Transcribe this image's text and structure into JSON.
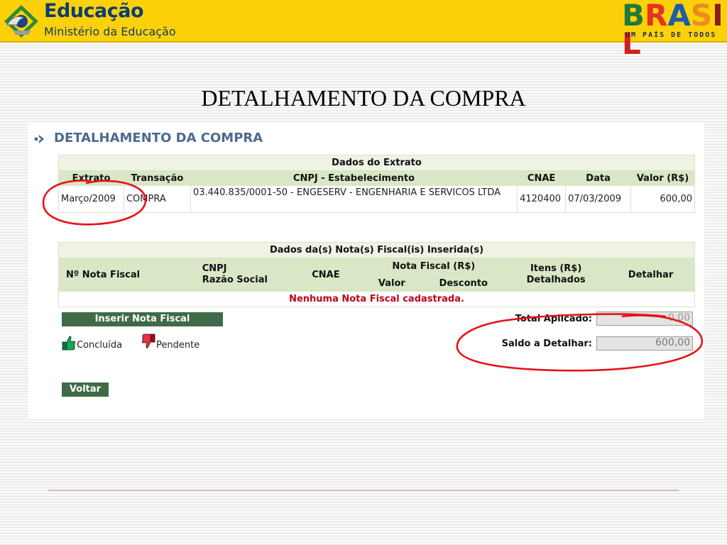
{
  "header": {
    "logo_title": "Educação",
    "logo_subtitle": "Ministério da Educação",
    "brasil_word": "BRASIL",
    "brasil_slogan": "UM PAÍS DE TODOS"
  },
  "slide_title": "DETALHAMENTO DA COMPRA",
  "page": {
    "section_title": "DETALHAMENTO DA COMPRA",
    "extrato": {
      "caption": "Dados do Extrato",
      "columns": [
        "Extrato",
        "Transação",
        "CNPJ - Estabelecimento",
        "CNAE",
        "Data",
        "Valor (R$)"
      ],
      "row": {
        "extrato": "Março/2009",
        "transacao": "COMPRA",
        "cnpj_estab": "03.440.835/0001-50 - ENGESERV - ENGENHARIA E SERVICOS LTDA",
        "cnae": "4120400",
        "data": "07/03/2009",
        "valor": "600,00"
      }
    },
    "notas": {
      "caption": "Dados da(s) Nota(s) Fiscal(is) Inserida(s)",
      "col_nota": "Nº Nota Fiscal",
      "col_cnpj": "CNPJ",
      "col_razao": "Razão Social",
      "col_cnae": "CNAE",
      "col_nf_group": "Nota Fiscal (R$)",
      "col_valor": "Valor",
      "col_desconto": "Desconto",
      "col_itens_1": "Itens (R$)",
      "col_itens_2": "Detalhados",
      "col_detalhar": "Detalhar",
      "empty_message": "Nenhuma Nota Fiscal cadastrada."
    },
    "insert_button": "Inserir Nota Fiscal",
    "legend": {
      "done": "Concluída",
      "pending": "Pendente"
    },
    "totals": {
      "aplicado_label": "Total Aplicado:",
      "aplicado_value": "0,00",
      "saldo_label": "Saldo a Detalhar:",
      "saldo_value": "600,00"
    },
    "back_button": "Voltar"
  },
  "colors": {
    "banner": "#fdd10a",
    "header_green": "#d9e7c6",
    "button_green": "#3f6b48",
    "message_red": "#c0001f",
    "annotation_red": "#e8101a"
  },
  "icons": {
    "logo": "ministry-emblem-icon",
    "section": "chevron-right-icon",
    "done": "thumbs-up-icon",
    "pending": "thumbs-down-icon"
  }
}
